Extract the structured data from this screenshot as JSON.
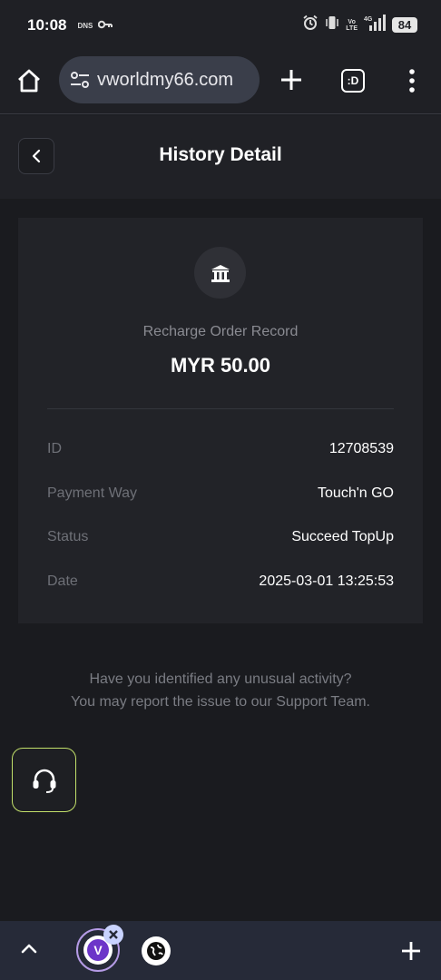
{
  "status_bar": {
    "time": "10:08",
    "dns_label": "DNS",
    "volte_top": "Vo",
    "volte_bottom": "LTE",
    "network": "4G",
    "battery": "84"
  },
  "browser": {
    "url": "vworldmy66.com",
    "tab_button_label": ":D"
  },
  "header": {
    "title": "History Detail"
  },
  "record": {
    "type_label": "Recharge Order Record",
    "amount": "MYR 50.00",
    "rows": [
      {
        "label": "ID",
        "value": "12708539"
      },
      {
        "label": "Payment Way",
        "value": "Touch'n GO"
      },
      {
        "label": "Status",
        "value": "Succeed TopUp"
      },
      {
        "label": "Date",
        "value": "2025-03-01 13:25:53"
      }
    ]
  },
  "notice": {
    "line1": "Have you identified any unusual activity?",
    "line2": "You may report the issue to our Support Team."
  },
  "tab_strip": {
    "active_tab_letter": "V"
  },
  "colors": {
    "background": "#1a1b1f",
    "card": "#222328",
    "support_border": "#c2e06a",
    "tab_accent": "#6c35c9"
  }
}
